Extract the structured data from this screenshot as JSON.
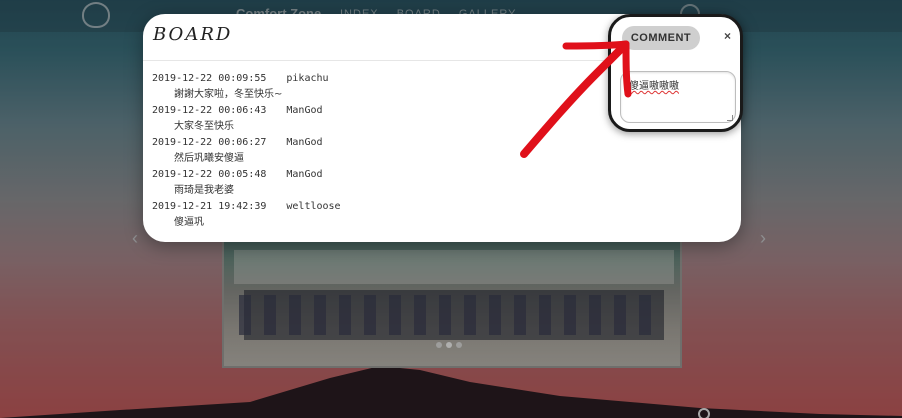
{
  "nav": {
    "title": "Comfort Zone",
    "links": [
      "INDEX",
      "BOARD",
      "GALLERY"
    ]
  },
  "board": {
    "title": "BOARD",
    "entries": [
      {
        "time": "2019-12-22 00:09:55",
        "user": "pikachu",
        "message": "謝謝大家啦，冬至快乐~"
      },
      {
        "time": "2019-12-22 00:06:43",
        "user": "ManGod",
        "message": "大家冬至快乐"
      },
      {
        "time": "2019-12-22 00:06:27",
        "user": "ManGod",
        "message": "然后巩曦安傻逼"
      },
      {
        "time": "2019-12-22 00:05:48",
        "user": "ManGod",
        "message": "雨琦是我老婆"
      },
      {
        "time": "2019-12-21 19:42:39",
        "user": "weltloose",
        "message": "傻逼巩"
      }
    ]
  },
  "comment": {
    "button_label": "COMMENT",
    "close_label": "×",
    "input_value": "傻逼嗷嗷嗷"
  },
  "slider": {
    "prev_label": "‹",
    "next_label": "›",
    "active_dot": 1
  },
  "colors": {
    "annotation_arrow": "#e0101a",
    "comment_button_bg": "#cfcfcf",
    "modal_bg": "#ffffff"
  }
}
